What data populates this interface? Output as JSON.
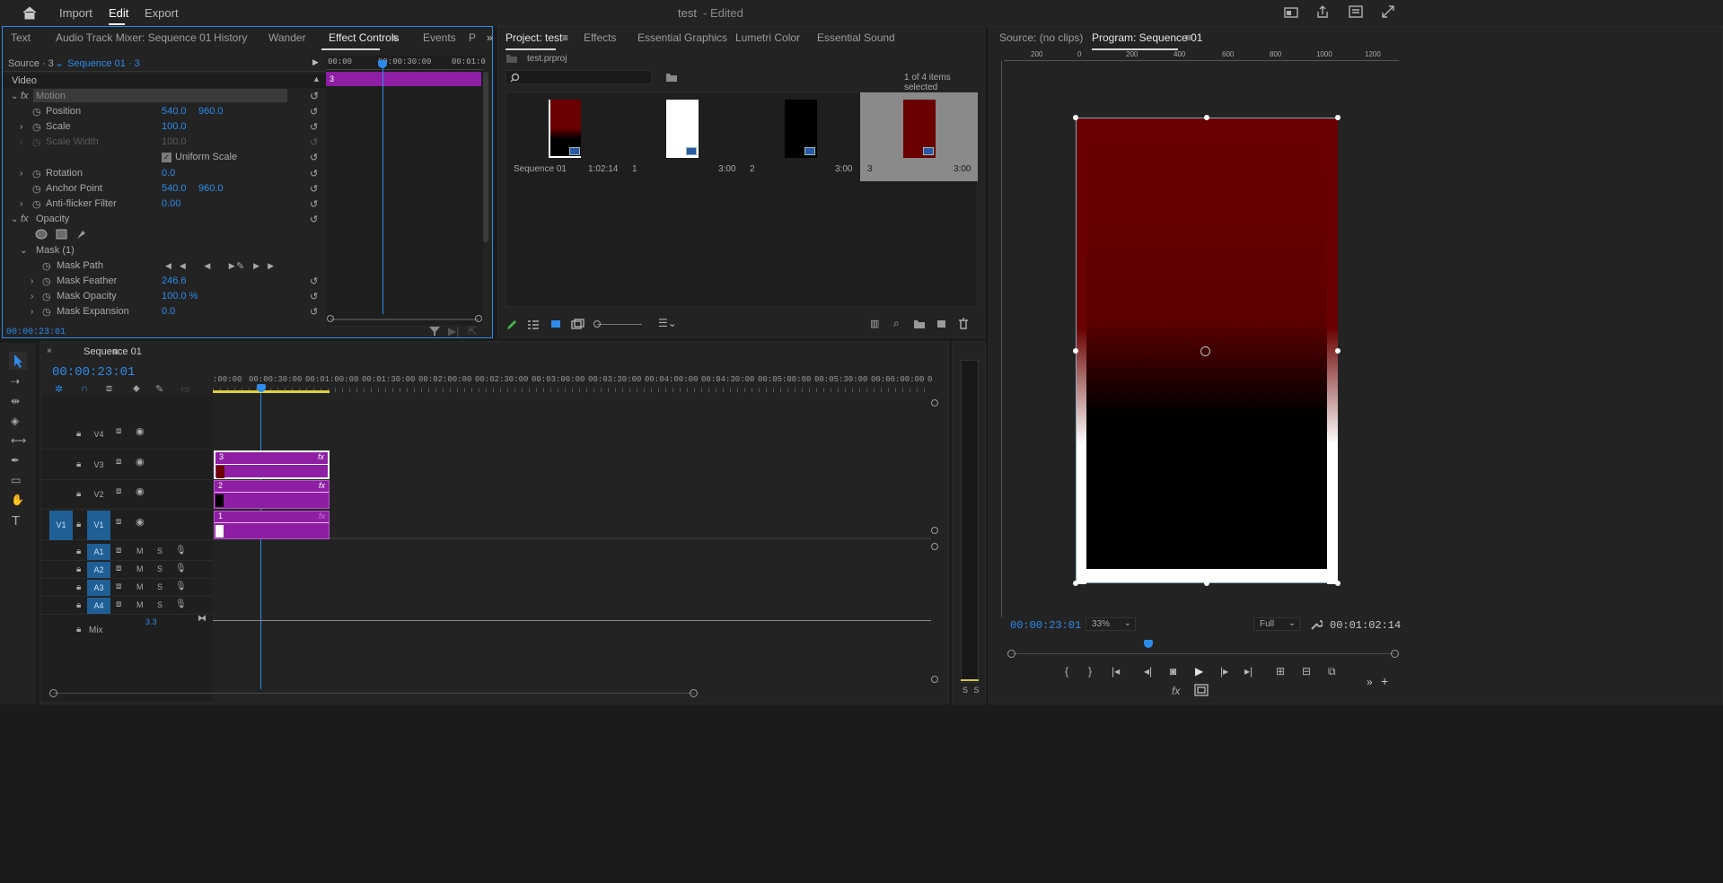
{
  "header": {
    "title": "test",
    "edited": "- Edited",
    "nav": [
      "Import",
      "Edit",
      "Export"
    ],
    "active": "Edit"
  },
  "left_tabs": [
    "Text",
    "Audio Track Mixer: Sequence 01",
    "History",
    "Wander",
    "Effect Controls",
    "Events",
    "P"
  ],
  "ec": {
    "source": "Source · 3",
    "sequence": "Sequence 01 · 3",
    "video_label": "Video",
    "ruler": [
      "00:00",
      "00:00:30:00",
      "00:01:0"
    ],
    "clip_name": "3",
    "rows": [
      {
        "name": "Motion",
        "v1": "",
        "v2": ""
      },
      {
        "name": "Position",
        "v1": "540.0",
        "v2": "960.0"
      },
      {
        "name": "Scale",
        "v1": "100.0",
        "v2": ""
      },
      {
        "name": "Scale Width",
        "v1": "100.0",
        "v2": ""
      },
      {
        "name": "Uniform Scale",
        "v1": "",
        "v2": ""
      },
      {
        "name": "Rotation",
        "v1": "0.0",
        "v2": ""
      },
      {
        "name": "Anchor Point",
        "v1": "540.0",
        "v2": "960.0"
      },
      {
        "name": "Anti-flicker Filter",
        "v1": "0.00",
        "v2": ""
      },
      {
        "name": "Opacity",
        "v1": "",
        "v2": ""
      },
      {
        "name": "Mask (1)",
        "v1": "",
        "v2": ""
      },
      {
        "name": "Mask Path",
        "v1": "",
        "v2": ""
      },
      {
        "name": "Mask Feather",
        "v1": "246.6",
        "v2": ""
      },
      {
        "name": "Mask Opacity",
        "v1": "100.0 %",
        "v2": ""
      },
      {
        "name": "Mask Expansion",
        "v1": "0.0",
        "v2": ""
      }
    ],
    "timecode": "00:00:23:01"
  },
  "project_tabs": [
    "Project: test",
    "Effects",
    "Essential Graphics",
    "Lumetri Color",
    "Essential Sound"
  ],
  "project": {
    "file": "test.prproj",
    "selected_info": "1 of 4 items selected",
    "items": [
      {
        "name": "Sequence 01",
        "dur": "1:02:14"
      },
      {
        "name": "1",
        "dur": "3:00"
      },
      {
        "name": "2",
        "dur": "3:00"
      },
      {
        "name": "3",
        "dur": "3:00"
      }
    ]
  },
  "monitor_tabs": [
    "Source: (no clips)",
    "Program: Sequence 01"
  ],
  "program": {
    "ruler": [
      "200",
      "0",
      "200",
      "400",
      "600",
      "800",
      "1000",
      "1200"
    ],
    "timecode": "00:00:23:01",
    "zoom": "33%",
    "quality": "Full",
    "duration": "00:01:02:14"
  },
  "timeline": {
    "tab": "Sequence 01",
    "timecode": "00:00:23:01",
    "ruler": [
      ":00:00",
      "00:00:30:00",
      "00:01:00:00",
      "00:01:30:00",
      "00:02:00:00",
      "00:02:30:00",
      "00:03:00:00",
      "00:03:30:00",
      "00:04:00:00",
      "00:04:30:00",
      "00:05:00:00",
      "00:05:30:00",
      "00:06:00:00",
      "0"
    ],
    "video_tracks": [
      "V4",
      "V3",
      "V2",
      "V1"
    ],
    "src_v1": "V1",
    "audio_tracks": [
      "A1",
      "A2",
      "A3",
      "A4"
    ],
    "mix_label": "Mix",
    "mix_value": "3.3",
    "clips": [
      "3",
      "2",
      "1"
    ],
    "m": "M",
    "s": "S",
    "meter": "S S"
  }
}
